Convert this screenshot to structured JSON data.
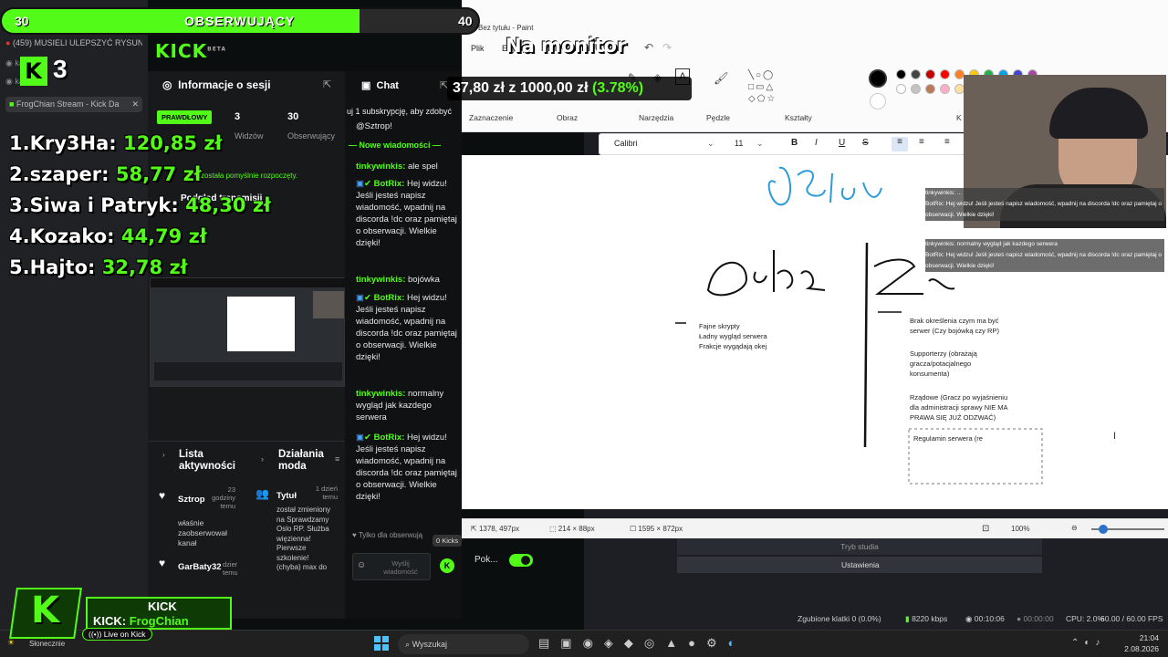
{
  "browser": {
    "tab_youtube": "(459) MUSIELI ULEPSZYĆ RYSUN",
    "tab_kick": "FrogChian Stream - Kick Da",
    "account_label_1": "karta",
    "account_label_2": "karta"
  },
  "goal": {
    "left_value": "30",
    "label": "OBSERWUJĄCY",
    "right_value": "40",
    "progress": 0.75
  },
  "leaderboard": [
    {
      "rank": "1.",
      "name": "Kry3Ha:",
      "amount": "120,85 zł"
    },
    {
      "rank": "2.",
      "name": "szaper:",
      "amount": "58,77 zł"
    },
    {
      "rank": "3.",
      "name": "Siwa i Patryk:",
      "amount": "48,30 zł"
    },
    {
      "rank": "4.",
      "name": "Kozako:",
      "amount": "44,79 zł"
    },
    {
      "rank": "5.",
      "name": "Hajto:",
      "amount": "32,78 zł"
    }
  ],
  "donation_goal": {
    "title": "Na monitor",
    "current": "37,80 zł",
    "of": "z",
    "target": "1000,00 zł",
    "percent": "(3.78%)"
  },
  "kick": {
    "logo": "KICK",
    "beta": "BETA",
    "session_title": "Informacje o sesji",
    "live_badge": "PRAWDŁOWY",
    "viewers_num": "3",
    "viewers_label": "Widzów",
    "followers_num": "30",
    "followers_label": "Obserwujący",
    "stream_started": "została pomyślnie rozpoczęty.",
    "preview_title": "Podgląd transmisji",
    "activity_title": "Lista aktywności",
    "mod_title": "Działania moda",
    "activity_items": [
      {
        "user": "Sztrop",
        "time": "23 godziny temu",
        "text": "właśnie zaobserwował kanał"
      },
      {
        "user": "GarBaty32",
        "time": "dzień temu",
        "text": ""
      }
    ],
    "mod_item": {
      "title": "Tytuł",
      "time": "1 dzień temu",
      "text": "został zmieniony na Sprawdzamy Oslo RP. Służba więzienna! Pierwsze szkolenie! (chyba) max do"
    },
    "chat_tab": "Chat",
    "chat_sub_banner": "uj 1 subskrypcję, aby zdobyć",
    "chat_mention": "@Sztrop!",
    "new_messages": "Nowe wiadomości",
    "messages": [
      {
        "user": "tinkywinkis:",
        "text": "ale spel"
      },
      {
        "user": "BotRix:",
        "text": "Hej widzu! Jeśli jesteś napisz wiadomość, wpadnij na discorda !dc oraz pamiętaj o obserwacji. Wielkie dzięki!"
      },
      {
        "user": "tinkywinkis:",
        "text": "bojówka"
      },
      {
        "user": "BotRix:",
        "text": "Hej widzu! Jeśli jesteś napisz wiadomość, wpadnij na discorda !dc oraz pamiętaj o obserwacji. Wielkie dzięki!"
      },
      {
        "user": "tinkywinkis:",
        "text": "normalny wygląd jak kazdego serwera"
      },
      {
        "user": "BotRix:",
        "text": "Hej widzu! Jeśli jesteś napisz wiadomość, wpadnij na discorda !dc oraz pamiętaj o obserwacji. Wielkie dzięki!"
      }
    ],
    "followers_only": "Tylko dla obserwują",
    "send_placeholder": "Wyślij wiadomość",
    "kicks_badge": "0 Kicks",
    "toggle_label": "Pok..."
  },
  "paint": {
    "window_title": "Bez tytułu - Paint",
    "menu_file": "Plik",
    "menu_edit": "Edytuj",
    "group_select": "Zaznaczenie",
    "group_image": "Obraz",
    "group_tools": "Narzędzia",
    "group_brushes": "Pędzle",
    "group_shapes": "Kształty",
    "group_colors": "K",
    "font_name": "Calibri",
    "font_size": "11",
    "bold": "B",
    "italic": "I",
    "underline": "U",
    "strike": "S",
    "notes_left": [
      "Fajne skrypty",
      "Ładny wygląd serwera",
      "Frakcje wygądają okej"
    ],
    "notes_right_1": [
      "Brak określenia czym ma być",
      "serwer (Czy bojówką czy RP)"
    ],
    "notes_right_2": [
      "Supporterzy (obrażają",
      "gracza/potacjalnego",
      "konsumenta)"
    ],
    "notes_right_3": [
      "Rządowe (Gracz po wyjaśnieniu",
      "dla administracji sprawy NIE MA",
      "PRAWA SIĘ JUŻ ODZWAĆ)"
    ],
    "text_box": "Regulamin serwera (re",
    "status_pos": "1378, 497px",
    "status_sel": "214 × 88px",
    "status_size": "1595 × 872px",
    "zoom": "100%",
    "colors": [
      "#000000",
      "#444444",
      "#c00000",
      "#ff0000",
      "#ff7f27",
      "#ffc90e",
      "#22b14c",
      "#00a2e8",
      "#3f48cc",
      "#a349a4",
      "#ffffff",
      "#c3c3c3",
      "#b97a57",
      "#ffaec9",
      "#ffe0a0",
      "#efe4b0",
      "#b5e61d",
      "#99d9ea",
      "#7092be",
      "#c8bfe7"
    ]
  },
  "overlay_chat": [
    "tinkywinkis: ...",
    "BotRix: Hej widzu! Jeśli jesteś napisz wiadomość, wpadnij na discorda !dc oraz pamiętaj o obserwacji. Wielkie dzięki!",
    "tinkywinkis: normalny wygląd jak kazdego serwera",
    "BotRix: Hej widzu! Jeśli jesteś napisz wiadomość, wpadnij na discorda !dc oraz pamiętaj o obserwacji. Wielkie dzięki!"
  ],
  "obs": {
    "studio_mode": "Tryb studia",
    "settings": "Ustawienia",
    "dropped_frames": "Zgubione klatki 0 (0.0%)",
    "bitrate": "8220 kbps",
    "live_time": "00:10:06",
    "rec_time": "00:00:00",
    "cpu": "CPU: 2.0%",
    "fps": "60.00 / 60.00 FPS"
  },
  "streamer_badge": {
    "kick_label": "KICK",
    "name_label": "KICK:",
    "name": "FrogChian",
    "live": "Live on Kick"
  },
  "taskbar": {
    "search": "Wyszukaj",
    "weather": "Słonecznie",
    "time": "21:04",
    "date": "2.08.2026"
  }
}
